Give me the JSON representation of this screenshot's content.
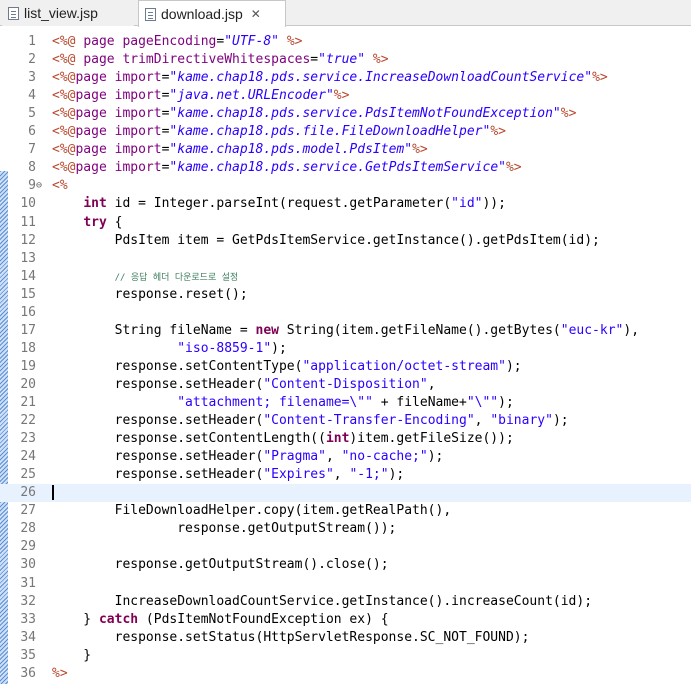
{
  "tabs": [
    {
      "label": "list_view.jsp",
      "icon": "file-icon",
      "active": false
    },
    {
      "label": "download.jsp",
      "icon": "file-icon",
      "active": true,
      "close_icon": "close-icon"
    }
  ],
  "editor": {
    "lines": [
      {
        "n": "1",
        "segs": [
          [
            "tag",
            "<%@ "
          ],
          [
            "kw",
            ""
          ],
          [
            "attr",
            "page "
          ],
          [
            "attr",
            "pageEncoding"
          ],
          [
            "",
            "="
          ],
          [
            "stri",
            "\"UTF-8\""
          ],
          [
            "tag",
            " %>"
          ]
        ]
      },
      {
        "n": "2",
        "segs": [
          [
            "tag",
            "<%@ "
          ],
          [
            "attr",
            "page "
          ],
          [
            "attr",
            "trimDirectiveWhitespaces"
          ],
          [
            "",
            "="
          ],
          [
            "stri",
            "\"true\""
          ],
          [
            "tag",
            " %>"
          ]
        ]
      },
      {
        "n": "3",
        "segs": [
          [
            "tag",
            "<%@"
          ],
          [
            "attr",
            "page "
          ],
          [
            "attr",
            "import"
          ],
          [
            "",
            "="
          ],
          [
            "stri",
            "\"kame.chap18.pds.service.IncreaseDownloadCountService\""
          ],
          [
            "tag",
            "%>"
          ]
        ]
      },
      {
        "n": "4",
        "segs": [
          [
            "tag",
            "<%@"
          ],
          [
            "attr",
            "page "
          ],
          [
            "attr",
            "import"
          ],
          [
            "",
            "="
          ],
          [
            "stri",
            "\"java.net.URLEncoder\""
          ],
          [
            "tag",
            "%>"
          ]
        ]
      },
      {
        "n": "5",
        "segs": [
          [
            "tag",
            "<%@"
          ],
          [
            "attr",
            "page "
          ],
          [
            "attr",
            "import"
          ],
          [
            "",
            "="
          ],
          [
            "stri",
            "\"kame.chap18.pds.service.PdsItemNotFoundException\""
          ],
          [
            "tag",
            "%>"
          ]
        ]
      },
      {
        "n": "6",
        "segs": [
          [
            "tag",
            "<%@"
          ],
          [
            "attr",
            "page "
          ],
          [
            "attr",
            "import"
          ],
          [
            "",
            "="
          ],
          [
            "stri",
            "\"kame.chap18.pds.file.FileDownloadHelper\""
          ],
          [
            "tag",
            "%>"
          ]
        ]
      },
      {
        "n": "7",
        "segs": [
          [
            "tag",
            "<%@"
          ],
          [
            "attr",
            "page "
          ],
          [
            "attr",
            "import"
          ],
          [
            "",
            "="
          ],
          [
            "stri",
            "\"kame.chap18.pds.model.PdsItem\""
          ],
          [
            "tag",
            "%>"
          ]
        ]
      },
      {
        "n": "8",
        "segs": [
          [
            "tag",
            "<%@"
          ],
          [
            "attr",
            "page "
          ],
          [
            "attr",
            "import"
          ],
          [
            "",
            "="
          ],
          [
            "stri",
            "\"kame.chap18.pds.service.GetPdsItemService\""
          ],
          [
            "tag",
            "%>"
          ]
        ]
      },
      {
        "n": "9",
        "fold": "⊖",
        "segs": [
          [
            "tag",
            "<%"
          ]
        ]
      },
      {
        "n": "10",
        "segs": [
          [
            "",
            "    "
          ],
          [
            "kw",
            "int"
          ],
          [
            "",
            " id = Integer.parseInt(request.getParameter("
          ],
          [
            "str",
            "\"id\""
          ],
          [
            "",
            "));"
          ]
        ]
      },
      {
        "n": "11",
        "segs": [
          [
            "",
            "    "
          ],
          [
            "kw",
            "try"
          ],
          [
            "",
            " {"
          ]
        ]
      },
      {
        "n": "12",
        "segs": [
          [
            "",
            "        PdsItem item = GetPdsItemService.getInstance().getPdsItem(id);"
          ]
        ]
      },
      {
        "n": "13",
        "segs": [
          [
            "",
            ""
          ]
        ]
      },
      {
        "n": "14",
        "segs": [
          [
            "",
            "        "
          ],
          [
            "com",
            "// 응답 헤더 다운로드로 설정"
          ]
        ]
      },
      {
        "n": "15",
        "segs": [
          [
            "",
            "        response.reset();"
          ]
        ]
      },
      {
        "n": "16",
        "segs": [
          [
            "",
            ""
          ]
        ]
      },
      {
        "n": "17",
        "segs": [
          [
            "",
            "        String fileName = "
          ],
          [
            "kw",
            "new"
          ],
          [
            "",
            " String(item.getFileName().getBytes("
          ],
          [
            "str",
            "\"euc-kr\""
          ],
          [
            "",
            "),"
          ]
        ]
      },
      {
        "n": "18",
        "segs": [
          [
            "",
            "                "
          ],
          [
            "str",
            "\"iso-8859-1\""
          ],
          [
            "",
            ");"
          ]
        ]
      },
      {
        "n": "19",
        "segs": [
          [
            "",
            "        response.setContentType("
          ],
          [
            "str",
            "\"application/octet-stream\""
          ],
          [
            "",
            ");"
          ]
        ]
      },
      {
        "n": "20",
        "segs": [
          [
            "",
            "        response.setHeader("
          ],
          [
            "str",
            "\"Content-Disposition\""
          ],
          [
            "",
            ","
          ]
        ]
      },
      {
        "n": "21",
        "segs": [
          [
            "",
            "                "
          ],
          [
            "str",
            "\"attachment; filename=\\\"\""
          ],
          [
            "",
            " + fileName+"
          ],
          [
            "str",
            "\"\\\"\""
          ],
          [
            "",
            ");"
          ]
        ]
      },
      {
        "n": "22",
        "segs": [
          [
            "",
            "        response.setHeader("
          ],
          [
            "str",
            "\"Content-Transfer-Encoding\""
          ],
          [
            "",
            ", "
          ],
          [
            "str",
            "\"binary\""
          ],
          [
            "",
            ");"
          ]
        ]
      },
      {
        "n": "23",
        "segs": [
          [
            "",
            "        response.setContentLength(("
          ],
          [
            "kw",
            "int"
          ],
          [
            "",
            ")item.getFileSize());"
          ]
        ]
      },
      {
        "n": "24",
        "segs": [
          [
            "",
            "        response.setHeader("
          ],
          [
            "str",
            "\"Pragma\""
          ],
          [
            "",
            ", "
          ],
          [
            "str",
            "\"no-cache;\""
          ],
          [
            "",
            ");"
          ]
        ]
      },
      {
        "n": "25",
        "segs": [
          [
            "",
            "        response.setHeader("
          ],
          [
            "str",
            "\"Expires\""
          ],
          [
            "",
            ", "
          ],
          [
            "str",
            "\"-1;\""
          ],
          [
            "",
            ");"
          ]
        ]
      },
      {
        "n": "26",
        "current": true,
        "segs": [
          [
            "",
            ""
          ]
        ]
      },
      {
        "n": "27",
        "segs": [
          [
            "",
            "        FileDownloadHelper.copy(item.getRealPath(),"
          ]
        ]
      },
      {
        "n": "28",
        "segs": [
          [
            "",
            "                response.getOutputStream());"
          ]
        ]
      },
      {
        "n": "29",
        "segs": [
          [
            "",
            ""
          ]
        ]
      },
      {
        "n": "30",
        "segs": [
          [
            "",
            "        response.getOutputStream().close();"
          ]
        ]
      },
      {
        "n": "31",
        "segs": [
          [
            "",
            ""
          ]
        ]
      },
      {
        "n": "32",
        "segs": [
          [
            "",
            "        IncreaseDownloadCountService.getInstance().increaseCount(id);"
          ]
        ]
      },
      {
        "n": "33",
        "segs": [
          [
            "",
            "    } "
          ],
          [
            "kw",
            "catch"
          ],
          [
            "",
            " (PdsItemNotFoundException ex) {"
          ]
        ]
      },
      {
        "n": "34",
        "segs": [
          [
            "",
            "        response.setStatus(HttpServletResponse.SC_NOT_FOUND);"
          ]
        ]
      },
      {
        "n": "35",
        "segs": [
          [
            "",
            "    }"
          ]
        ]
      },
      {
        "n": "36",
        "segs": [
          [
            "tag",
            "%>"
          ]
        ]
      }
    ]
  }
}
